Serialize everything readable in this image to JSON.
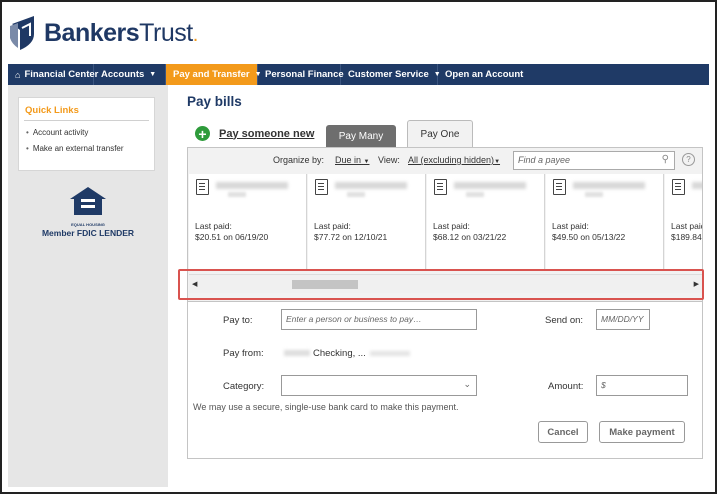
{
  "brand": {
    "name_bold": "Bankers",
    "name_rest": "Trust",
    "mark": "."
  },
  "nav": {
    "items": [
      {
        "label": "Financial Center",
        "icon": "home-icon",
        "active": false,
        "has_caret": false
      },
      {
        "label": "Accounts",
        "active": false,
        "has_caret": true
      },
      {
        "label": "Pay and Transfer",
        "active": true,
        "has_caret": true
      },
      {
        "label": "Personal Finance",
        "active": false,
        "has_caret": false
      },
      {
        "label": "Customer Service",
        "active": false,
        "has_caret": true
      },
      {
        "label": "Open an Account",
        "active": false,
        "has_caret": false
      }
    ],
    "active_color": "#f39a1b",
    "bar_color": "#1f3a66"
  },
  "sidebar": {
    "quick_links_title": "Quick Links",
    "links": [
      "Account activity",
      "Make an external transfer"
    ],
    "fdic_small": "EQUAL HOUSING",
    "fdic_label": "Member FDIC LENDER"
  },
  "main": {
    "title": "Pay bills",
    "pay_new_label": "Pay someone new",
    "tabs": [
      {
        "label": "Pay Many",
        "active": false
      },
      {
        "label": "Pay One",
        "active": true
      }
    ],
    "toolbar": {
      "organize_label": "Organize by:",
      "organize_value": "Due in",
      "view_label": "View:",
      "view_value": "All (excluding hidden)",
      "find_placeholder": "Find a payee"
    },
    "payees": [
      {
        "last_paid_label": "Last paid:",
        "last_paid_value": "$20.51 on 06/19/20"
      },
      {
        "last_paid_label": "Last paid:",
        "last_paid_value": "$77.72 on 12/10/21"
      },
      {
        "last_paid_label": "Last paid:",
        "last_paid_value": "$68.12 on 03/21/22"
      },
      {
        "last_paid_label": "Last paid:",
        "last_paid_value": "$49.50 on 05/13/22"
      },
      {
        "last_paid_label": "Last paid:",
        "last_paid_value": "$189.84"
      }
    ],
    "form": {
      "pay_to_label": "Pay to:",
      "pay_to_placeholder": "Enter a person or business to pay…",
      "send_on_label": "Send on:",
      "send_on_placeholder": "MM/DD/YY",
      "pay_from_label": "Pay from:",
      "pay_from_value": "Checking, ...",
      "category_label": "Category:",
      "amount_label": "Amount:",
      "amount_placeholder": "$",
      "note": "We may use a secure, single-use bank card to make this payment.",
      "cancel_label": "Cancel",
      "submit_label": "Make payment"
    }
  }
}
